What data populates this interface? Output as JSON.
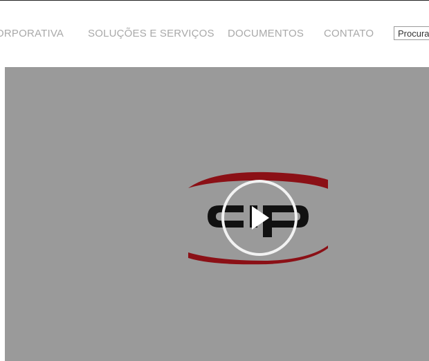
{
  "nav": {
    "items": [
      {
        "label": "ORPORATIVA"
      },
      {
        "label": "SOLUÇÕES E SERVIÇOS"
      },
      {
        "label": "DOCUMENTOS"
      },
      {
        "label": "CONTATO"
      }
    ]
  },
  "search": {
    "placeholder": "Procurar",
    "value": ""
  },
  "video": {
    "logo_text": "cip",
    "play_icon": "play-icon"
  },
  "colors": {
    "nav_text": "#a9a9a9",
    "video_bg": "#9a9a9a",
    "logo_red": "#8b1016",
    "logo_black": "#111111"
  }
}
